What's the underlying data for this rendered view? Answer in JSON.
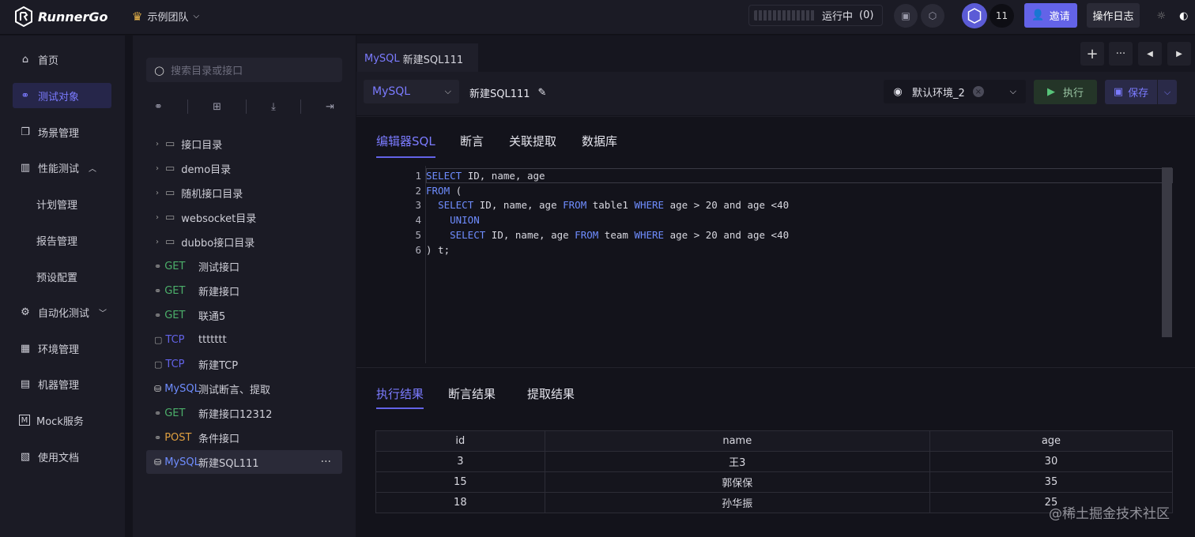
{
  "app": {
    "name": "RunnerGo",
    "team": "示例团队"
  },
  "topbar": {
    "running_label": "运行中",
    "running_count": "(0)",
    "member_count": "11",
    "invite_label": "邀请",
    "oplog_label": "操作日志"
  },
  "sidebar": {
    "items": [
      {
        "label": "首页"
      },
      {
        "label": "测试对象"
      },
      {
        "label": "场景管理"
      },
      {
        "label": "性能测试"
      },
      {
        "label": "计划管理"
      },
      {
        "label": "报告管理"
      },
      {
        "label": "预设配置"
      },
      {
        "label": "自动化测试"
      },
      {
        "label": "环境管理"
      },
      {
        "label": "机器管理"
      },
      {
        "label": "Mock服务"
      },
      {
        "label": "使用文档"
      }
    ]
  },
  "tree": {
    "search_placeholder": "搜索目录或接口",
    "folders": [
      "接口目录",
      "demo目录",
      "随机接口目录",
      "websocket目录",
      "dubbo接口目录"
    ],
    "items": [
      {
        "method": "GET",
        "name": "测试接口",
        "color": "#4caf6a"
      },
      {
        "method": "GET",
        "name": "新建接口",
        "color": "#4caf6a"
      },
      {
        "method": "GET",
        "name": "联通5",
        "color": "#4caf6a"
      },
      {
        "method": "TCP",
        "name": "ttttttt",
        "color": "#6363e8"
      },
      {
        "method": "TCP",
        "name": "新建TCP",
        "color": "#6363e8"
      },
      {
        "method": "MySQL",
        "name": "测试断言、提取",
        "color": "#6f8dff"
      },
      {
        "method": "GET",
        "name": "新建接口12312",
        "color": "#4caf6a"
      },
      {
        "method": "POST",
        "name": "条件接口",
        "color": "#e0a040"
      },
      {
        "method": "MySQL",
        "name": "新建SQL111",
        "color": "#6f8dff"
      }
    ]
  },
  "tab": {
    "type": "MySQL",
    "name": "新建SQL111"
  },
  "toolbar": {
    "db_type": "MySQL",
    "sql_name": "新建SQL111",
    "env": "默认环境_2",
    "run_label": "执行",
    "save_label": "保存"
  },
  "subtabs": [
    "编辑器SQL",
    "断言",
    "关联提取",
    "数据库"
  ],
  "editor": {
    "lines": [
      "SELECT ID, name, age",
      "FROM (",
      "  SELECT ID, name, age FROM table1 WHERE age > 20 and age <40",
      "    UNION",
      "    SELECT ID, name, age FROM team WHERE age > 20 and age <40",
      ") t;"
    ]
  },
  "result_tabs": [
    "执行结果",
    "断言结果",
    "提取结果"
  ],
  "result_table": {
    "columns": [
      "id",
      "name",
      "age"
    ],
    "rows": [
      [
        "3",
        "王3",
        "30"
      ],
      [
        "15",
        "郭保保",
        "35"
      ],
      [
        "18",
        "孙华振",
        "25"
      ]
    ]
  },
  "watermark": "@稀土掘金技术社区"
}
